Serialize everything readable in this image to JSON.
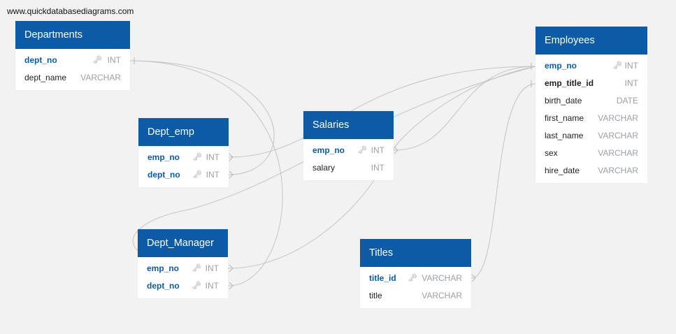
{
  "watermark": "www.quickdatabasediagrams.com",
  "colors": {
    "header": "#0b5ba7",
    "background": "#f1f2f1",
    "link": "#c4c4c4"
  },
  "tables": {
    "departments": {
      "title": "Departments",
      "rows": [
        {
          "name": "dept_no",
          "type": "INT",
          "key": "key-icon"
        },
        {
          "name": "dept_name",
          "type": "VARCHAR"
        }
      ]
    },
    "dept_emp": {
      "title": "Dept_emp",
      "rows": [
        {
          "name": "emp_no",
          "type": "INT",
          "key": "key-icon"
        },
        {
          "name": "dept_no",
          "type": "INT",
          "key": "key-icon"
        }
      ]
    },
    "dept_manager": {
      "title": "Dept_Manager",
      "rows": [
        {
          "name": "emp_no",
          "type": "INT",
          "key": "key-icon"
        },
        {
          "name": "dept_no",
          "type": "INT",
          "key": "key-icon"
        }
      ]
    },
    "salaries": {
      "title": "Salaries",
      "rows": [
        {
          "name": "emp_no",
          "type": "INT",
          "key": "key-icon"
        },
        {
          "name": "salary",
          "type": "INT"
        }
      ]
    },
    "titles": {
      "title": "Titles",
      "rows": [
        {
          "name": "title_id",
          "type": "VARCHAR",
          "key": "key-icon"
        },
        {
          "name": "title",
          "type": "VARCHAR"
        }
      ]
    },
    "employees": {
      "title": "Employees",
      "rows": [
        {
          "name": "emp_no",
          "type": "INT",
          "key": "key-icon"
        },
        {
          "name": "emp_title_id",
          "type": "INT"
        },
        {
          "name": "birth_date",
          "type": "DATE"
        },
        {
          "name": "first_name",
          "type": "VARCHAR"
        },
        {
          "name": "last_name",
          "type": "VARCHAR"
        },
        {
          "name": "sex",
          "type": "VARCHAR"
        },
        {
          "name": "hire_date",
          "type": "VARCHAR"
        }
      ]
    }
  }
}
